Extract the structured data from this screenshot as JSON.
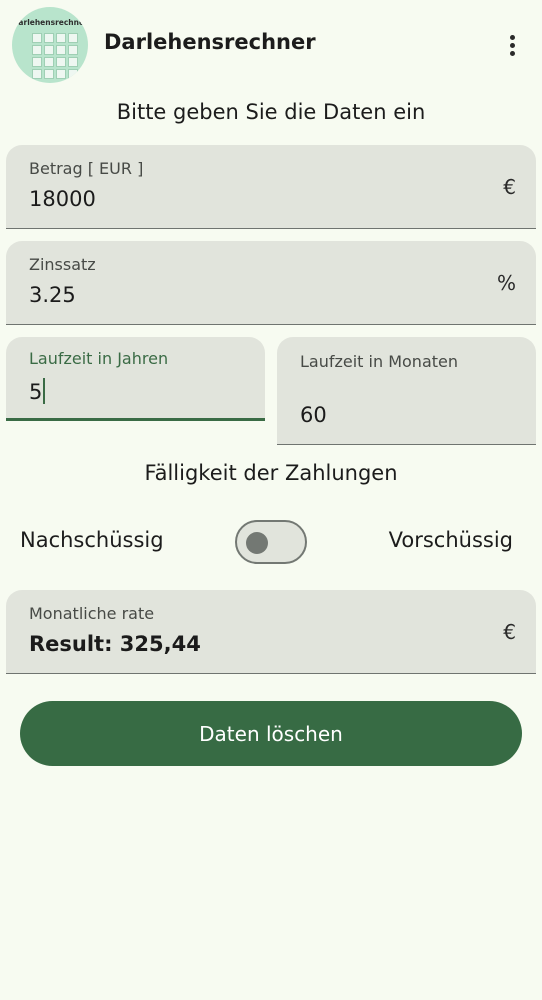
{
  "appbar": {
    "title": "Darlehensrechner",
    "icon_label": "Darlehensrechner",
    "menu_icon": "more-vert-icon"
  },
  "heading": "Bitte geben Sie die Daten ein",
  "fields": {
    "betrag": {
      "label": "Betrag [ EUR ]",
      "value": "18000",
      "suffix": "€"
    },
    "zinssatz": {
      "label": "Zinssatz",
      "value": "3.25",
      "suffix": "%"
    },
    "laufzeit_jahre": {
      "label": "Laufzeit in Jahren",
      "value": "5"
    },
    "laufzeit_monate": {
      "label": "Laufzeit in Monaten",
      "value": "60"
    }
  },
  "faelligkeit": {
    "title": "Fälligkeit der Zahlungen",
    "left_option": "Nachschüssig",
    "right_option": "Vorschüssig",
    "switch_on": false
  },
  "result": {
    "label": "Monatliche rate",
    "value": "Result: 325,44",
    "suffix": "€"
  },
  "clear_button": {
    "label": "Daten löschen"
  },
  "colors": {
    "background": "#f7fbf1",
    "field_bg": "#e1e4dc",
    "primary": "#376b44",
    "focused_label": "#3a6b45"
  }
}
